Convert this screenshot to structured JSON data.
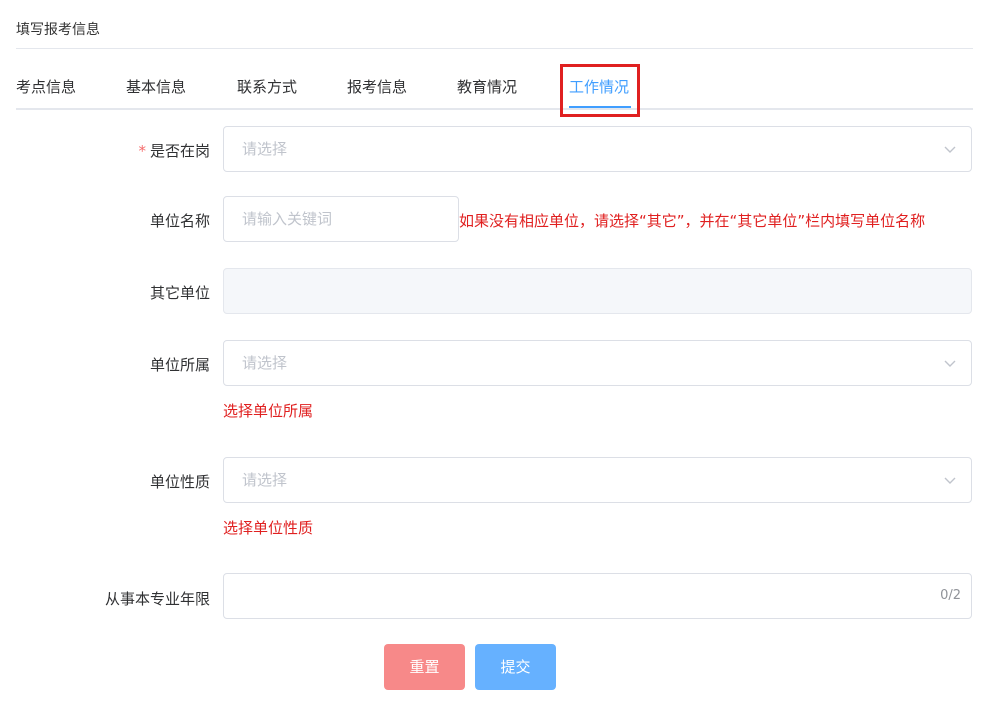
{
  "page": {
    "title": "填写报考信息"
  },
  "tabs": [
    {
      "label": "考点信息"
    },
    {
      "label": "基本信息"
    },
    {
      "label": "联系方式"
    },
    {
      "label": "报考信息"
    },
    {
      "label": "教育情况"
    },
    {
      "label": "工作情况",
      "active": true
    }
  ],
  "form": {
    "on_duty": {
      "required_mark": "*",
      "label": "是否在岗",
      "placeholder": "请选择"
    },
    "unit_name": {
      "label": "单位名称",
      "placeholder": "请输入关键词",
      "hint": "如果没有相应单位，请选择“其它”，并在“其它单位”栏内填写单位名称"
    },
    "other_unit": {
      "label": "其它单位",
      "value": ""
    },
    "unit_affiliation": {
      "label": "单位所属",
      "placeholder": "请选择",
      "error": "选择单位所属"
    },
    "unit_nature": {
      "label": "单位性质",
      "placeholder": "请选择",
      "error": "选择单位性质"
    },
    "years": {
      "label": "从事本专业年限",
      "value": "",
      "counter": "0/2"
    }
  },
  "buttons": {
    "reset": "重置",
    "submit": "提交"
  },
  "colors": {
    "accent": "#409eff",
    "error": "#e02020",
    "reset": "#f78989",
    "submit": "#66b1ff"
  }
}
